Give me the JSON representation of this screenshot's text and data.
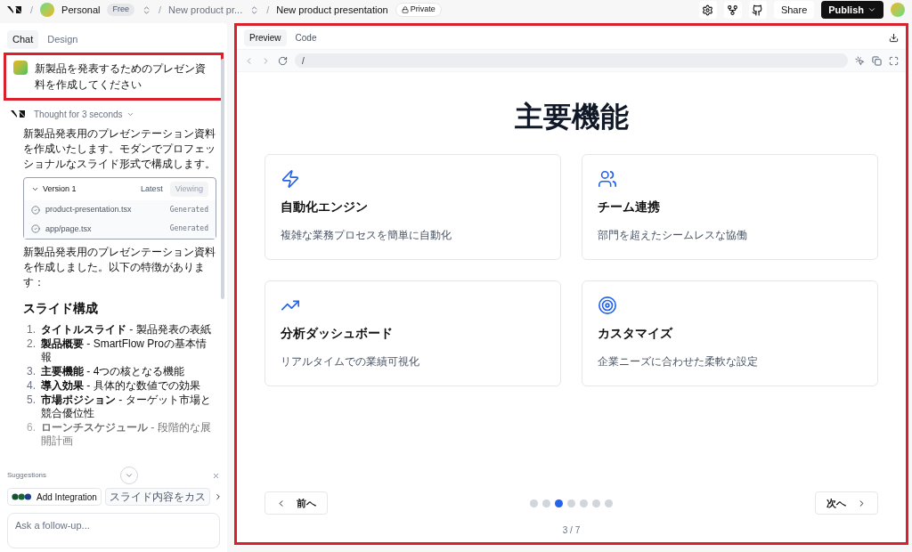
{
  "header": {
    "separators": [
      "/",
      "/",
      "/"
    ],
    "workspace": "Personal",
    "plan": "Free",
    "project": "New product pr...",
    "title": "New product presentation",
    "visibility": "Private",
    "share": "Share",
    "publish": "Publish"
  },
  "left_tabs": [
    {
      "label": "Chat",
      "selected": true
    },
    {
      "label": "Design",
      "selected": false
    }
  ],
  "user_message": {
    "text": "新製品を発表するためのプレゼン資料を作成してください",
    "highlighted": true
  },
  "thought": "Thought for 3 seconds",
  "intro": "新製品発表用のプレゼンテーション資料を作成いたします。モダンでプロフェッショナルなスライド形式で構成します。",
  "version": {
    "title": "Version 1",
    "latest": "Latest",
    "viewing": "Viewing",
    "files": [
      {
        "name": "product-presentation.tsx",
        "status": "Generated"
      },
      {
        "name": "app/page.tsx",
        "status": "Generated"
      }
    ]
  },
  "summary": "新製品発表用のプレゼンテーション資料を作成しました。以下の特徴があります：",
  "section_title": "スライド構成",
  "slide_list": [
    {
      "number": "1.",
      "title": "タイトルスライド",
      "detail": " - 製品発表の表紙"
    },
    {
      "number": "2.",
      "title": "製品概要",
      "detail": " - SmartFlow Proの基本情報"
    },
    {
      "number": "3.",
      "title": "主要機能",
      "detail": " - 4つの核となる機能"
    },
    {
      "number": "4.",
      "title": "導入効果",
      "detail": " - 具体的な数値での効果"
    },
    {
      "number": "5.",
      "title": "市場ポジション",
      "detail": " - ターゲット市場と競合優位性"
    },
    {
      "number": "6.",
      "title": "ローンチスケジュール",
      "detail": " - 段階的な展開計画"
    }
  ],
  "suggestions": {
    "label": "Suggestions",
    "chips": [
      "Add Integration",
      "スライド内容をカス"
    ]
  },
  "followup": {
    "placeholder": "Ask a follow-up..."
  },
  "preview": {
    "highlighted": true,
    "tabs": [
      {
        "label": "Preview",
        "selected": true
      },
      {
        "label": "Code",
        "selected": false
      }
    ],
    "url": "/",
    "slide": {
      "title": "主要機能",
      "features": [
        {
          "kind": "bolt",
          "title": "自動化エンジン",
          "text": "複雑な業務プロセスを簡単に自動化"
        },
        {
          "kind": "users",
          "title": "チーム連携",
          "text": "部門を超えたシームレスな協働"
        },
        {
          "kind": "trend",
          "title": "分析ダッシュボード",
          "text": "リアルタイムでの業績可視化"
        },
        {
          "kind": "target",
          "title": "カスタマイズ",
          "text": "企業ニーズに合わせた柔軟な設定"
        }
      ]
    },
    "prev": "前へ",
    "next": "次へ",
    "dots": [
      {
        "selected": false
      },
      {
        "selected": false
      },
      {
        "selected": true
      },
      {
        "selected": false
      },
      {
        "selected": false
      },
      {
        "selected": false
      },
      {
        "selected": false
      }
    ],
    "counter": "3 / 7"
  }
}
